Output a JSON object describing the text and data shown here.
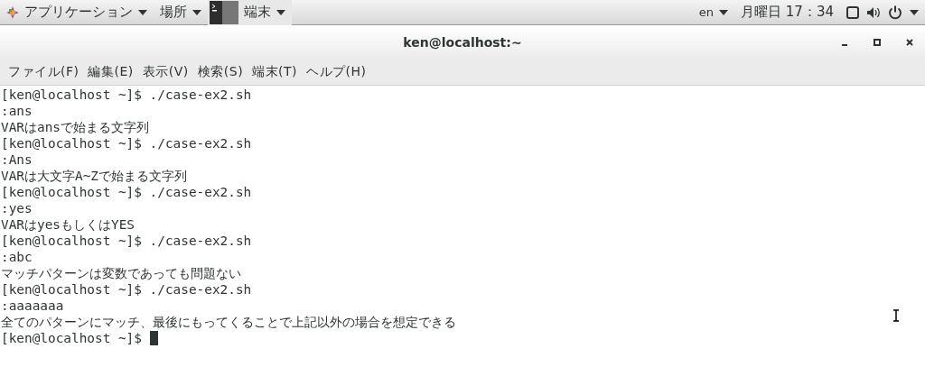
{
  "top_bar": {
    "apps_menu": "アプリケーション",
    "places_menu": "場所",
    "task": "端末",
    "language": "en",
    "clock": "月曜日 17：34"
  },
  "window": {
    "title": "ken@localhost:~"
  },
  "menu": [
    "ファイル(F)",
    "編集(E)",
    "表示(V)",
    "検索(S)",
    "端末(T)",
    "ヘルプ(H)"
  ],
  "terminal": {
    "cursor_visible": true,
    "lines": [
      "[ken@localhost ~]$ ./case-ex2.sh",
      ":ans",
      "VARはansで始まる文字列",
      "[ken@localhost ~]$ ./case-ex2.sh",
      ":Ans",
      "VARは大文字A~Zで始まる文字列",
      "[ken@localhost ~]$ ./case-ex2.sh",
      ":yes",
      "VARはyesもしくはYES",
      "[ken@localhost ~]$ ./case-ex2.sh",
      ":abc",
      "マッチパターンは変数であっても問題ない",
      "[ken@localhost ~]$ ./case-ex2.sh",
      ":aaaaaaa",
      "全てのパターンにマッチ、最後にもってくることで上記以外の場合を想定できる",
      "[ken@localhost ~]$ "
    ]
  }
}
